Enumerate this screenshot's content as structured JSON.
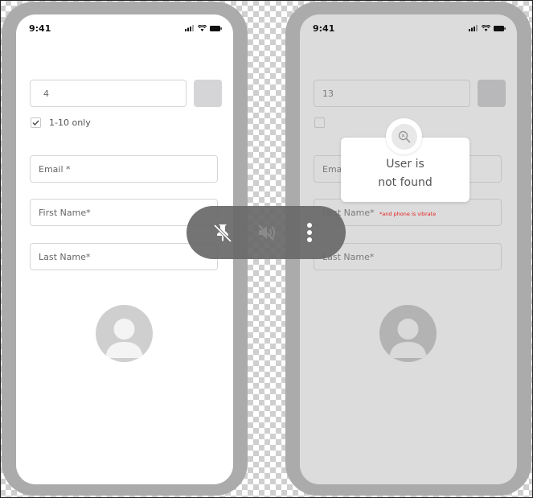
{
  "left_phone": {
    "status_time": "9:41",
    "number_value": "4",
    "range_label": "1-10 only",
    "range_checked": true,
    "email_placeholder": "Email *",
    "first_name_placeholder": "First Name*",
    "last_name_placeholder": "Last Name*"
  },
  "right_phone": {
    "status_time": "9:41",
    "number_value": "13",
    "range_checked": false,
    "email_placeholder_partial": "Emai",
    "first_name_placeholder": "First Name*",
    "last_name_placeholder": "Last Name*",
    "toast": {
      "line1": "User is",
      "line2": "not found",
      "icon": "search-icon"
    },
    "vibrate_note": "*and phone is vibrate",
    "vibrate_note_color": "#e62020"
  },
  "overlay_toolbar": {
    "buttons": [
      {
        "icon": "unpin-icon"
      },
      {
        "icon": "mute-icon"
      },
      {
        "icon": "more-vertical-icon"
      }
    ]
  }
}
